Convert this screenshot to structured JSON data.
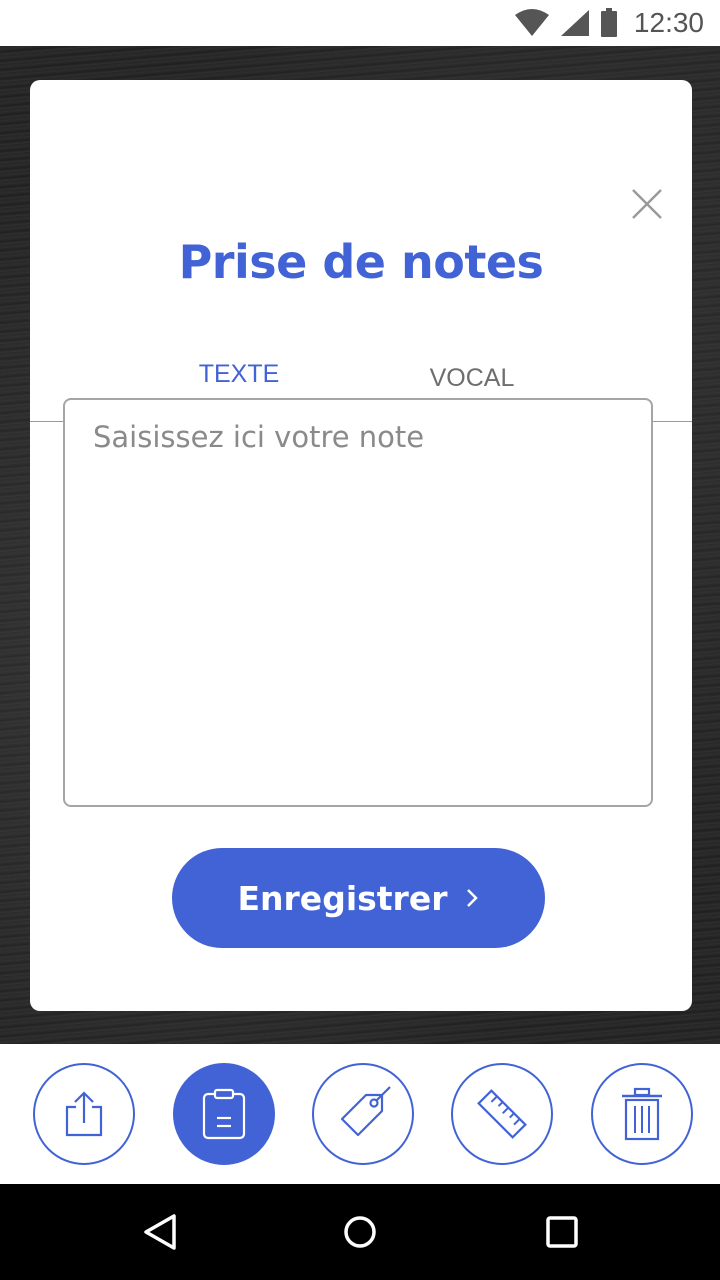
{
  "status_bar": {
    "time": "12:30",
    "icons": [
      "wifi-icon",
      "signal-icon",
      "battery-icon"
    ]
  },
  "modal": {
    "title": "Prise de notes",
    "close_icon": "close-icon",
    "tabs": [
      {
        "label": "TEXTE",
        "active": true
      },
      {
        "label": "VOCAL",
        "active": false
      }
    ],
    "note": {
      "value": "",
      "placeholder": "Saisissez ici votre note"
    },
    "save_button": {
      "label": "Enregistrer",
      "icon": "chevron-right-icon"
    }
  },
  "toolbar": {
    "items": [
      {
        "name": "share",
        "icon": "share-icon",
        "active": false
      },
      {
        "name": "notes",
        "icon": "clipboard-icon",
        "active": true
      },
      {
        "name": "tag",
        "icon": "tag-icon",
        "active": false
      },
      {
        "name": "measure",
        "icon": "ruler-icon",
        "active": false
      },
      {
        "name": "delete",
        "icon": "trash-icon",
        "active": false
      }
    ]
  },
  "navigation": {
    "items": [
      "back-icon",
      "home-icon",
      "recents-icon"
    ]
  },
  "colors": {
    "accent": "#4263d6",
    "tab_inactive": "#6e6e6e",
    "placeholder": "#8a8a8a",
    "status_bar_bg": "#ffffff",
    "nav_bar_bg": "#000000"
  }
}
